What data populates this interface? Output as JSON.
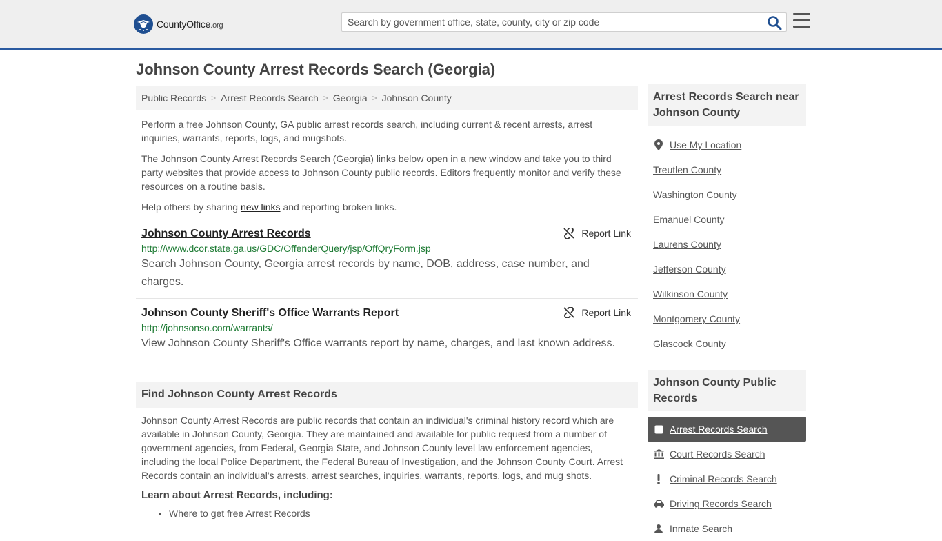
{
  "header": {
    "logo_main": "CountyOffice",
    "logo_domain": ".org",
    "search_placeholder": "Search by government office, state, county, city or zip code"
  },
  "page_title": "Johnson County Arrest Records Search (Georgia)",
  "breadcrumb": [
    "Public Records",
    "Arrest Records Search",
    "Georgia",
    "Johnson County"
  ],
  "intro": {
    "p1": "Perform a free Johnson County, GA public arrest records search, including current & recent arrests, arrest inquiries, warrants, reports, logs, and mugshots.",
    "p2": "The Johnson County Arrest Records Search (Georgia) links below open in a new window and take you to third party websites that provide access to Johnson County public records. Editors frequently monitor and verify these resources on a routine basis.",
    "p3_before": "Help others by sharing ",
    "p3_link": "new links",
    "p3_after": " and reporting broken links."
  },
  "results": [
    {
      "title": "Johnson County Arrest Records",
      "url": "http://www.dcor.state.ga.us/GDC/OffenderQuery/jsp/OffQryForm.jsp",
      "desc": "Search Johnson County, Georgia arrest records by name, DOB, address, case number, and charges.",
      "report": "Report Link"
    },
    {
      "title": "Johnson County Sheriff's Office Warrants Report",
      "url": "http://johnsonso.com/warrants/",
      "desc": "View Johnson County Sheriff's Office warrants report by name, charges, and last known address.",
      "report": "Report Link"
    }
  ],
  "find": {
    "heading": "Find Johnson County Arrest Records",
    "text": "Johnson County Arrest Records are public records that contain an individual's criminal history record which are available in Johnson County, Georgia. They are maintained and available for public request from a number of government agencies, from Federal, Georgia State, and Johnson County level law enforcement agencies, including the local Police Department, the Federal Bureau of Investigation, and the Johnson County Court. Arrest Records contain an individual's arrests, arrest searches, inquiries, warrants, reports, logs, and mug shots.",
    "learn_heading": "Learn about Arrest Records, including:",
    "learn_items": [
      "Where to get free Arrest Records"
    ]
  },
  "sidebar": {
    "near_heading": "Arrest Records Search near Johnson County",
    "use_location": "Use My Location",
    "near_items": [
      "Treutlen County",
      "Washington County",
      "Emanuel County",
      "Laurens County",
      "Jefferson County",
      "Wilkinson County",
      "Montgomery County",
      "Glascock County"
    ],
    "public_heading": "Johnson County Public Records",
    "public_items": [
      {
        "label": "Arrest Records Search",
        "icon": "square-icon"
      },
      {
        "label": "Court Records Search",
        "icon": "courthouse-icon"
      },
      {
        "label": "Criminal Records Search",
        "icon": "exclamation-icon"
      },
      {
        "label": "Driving Records Search",
        "icon": "car-icon"
      },
      {
        "label": "Inmate Search",
        "icon": "inmate-icon"
      }
    ]
  },
  "colors": {
    "accent": "#2a5aa0",
    "url_green": "#1e7b34",
    "active_bg": "#555555"
  }
}
